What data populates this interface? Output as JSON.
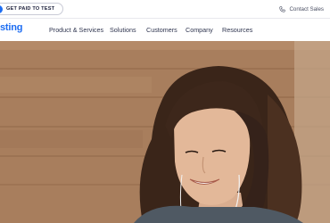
{
  "topbar": {
    "promo_label": "GET PAID TO TEST",
    "contact_label": "Contact Sales",
    "contact_icon": "phone-icon"
  },
  "navbar": {
    "logo_text": "sting",
    "items": [
      {
        "label": "Product & Services"
      },
      {
        "label": "Solutions"
      },
      {
        "label": "Customers"
      },
      {
        "label": "Company"
      },
      {
        "label": "Resources"
      }
    ]
  },
  "hero": {
    "image": "woman-with-earbuds-photo"
  },
  "colors": {
    "brand": "#1d6df2",
    "nav_text": "#303650",
    "wall": "#a57b5a"
  }
}
